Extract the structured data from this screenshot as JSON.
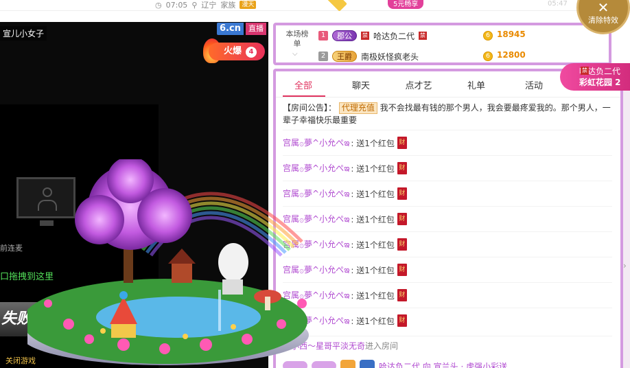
{
  "topbar": {
    "time": "07:05",
    "location": "辽宁",
    "family_label": "家族",
    "family_badge": "漫天",
    "promo": "5元畅享",
    "faint_text": "05:47"
  },
  "clear_effects": {
    "icon": "close-x-icon",
    "label": "清除特效"
  },
  "video": {
    "room_title": "宣儿小女子",
    "logo": "6.cn",
    "live_label": "直播",
    "hot_label": "火爆",
    "hot_count": "4",
    "lianmai": "前连麦",
    "drag_hint": "口拖拽到这里",
    "fail_text": "失败",
    "close_game": "关闭游戏"
  },
  "ranking": {
    "label": "本场榜单",
    "rows": [
      {
        "index": "1",
        "title": "郡公",
        "tag": "禁",
        "name": "哈达负二代",
        "score": "18945"
      },
      {
        "index": "2",
        "title": "王爵",
        "tag": "",
        "name": "南极妖怪疯老头",
        "score": "12800"
      }
    ]
  },
  "float_notice": {
    "tag": "禁",
    "line1": "哈达负二代",
    "line2": "彩虹花园 2"
  },
  "chat": {
    "tabs": [
      "全部",
      "聊天",
      "点才艺",
      "礼单",
      "活动"
    ],
    "active_tab": "全部",
    "notice_prefix": "【房间公告】：",
    "notice_agent": "代理充值",
    "notice_text": "我不会找最有钱的那个男人，我会要最疼爱我的。那个男人，一辈子幸福快乐最重要",
    "messages": [
      {
        "who": "宫属۞夢^小允ぺఇ",
        "what": ": 送1个红包"
      },
      {
        "who": "宫属۞夢^小允ぺఇ",
        "what": ": 送1个红包"
      },
      {
        "who": "宫属۞夢^小允ぺఇ",
        "what": ": 送1个红包"
      },
      {
        "who": "宫属۞夢^小允ぺఇ",
        "what": ": 送1个红包"
      },
      {
        "who": "宫属۞夢^小允ぺఇ",
        "what": ": 送1个红包"
      },
      {
        "who": "宫属۞夢^小允ぺఇ",
        "what": ": 送1个红包"
      },
      {
        "who": "宫属۞夢^小允ぺఇ",
        "what": ": 送1个红包"
      },
      {
        "who": "宫属۞夢^小允ぺఇ",
        "what": ": 送1个红包"
      }
    ],
    "envelope_glyph": "财",
    "enter_name": "小小西～星哥平淡无奇",
    "enter_text": "进入房间",
    "bottom_text": "哈达负二代 向 宣兰头 · 虎强小彩送"
  }
}
